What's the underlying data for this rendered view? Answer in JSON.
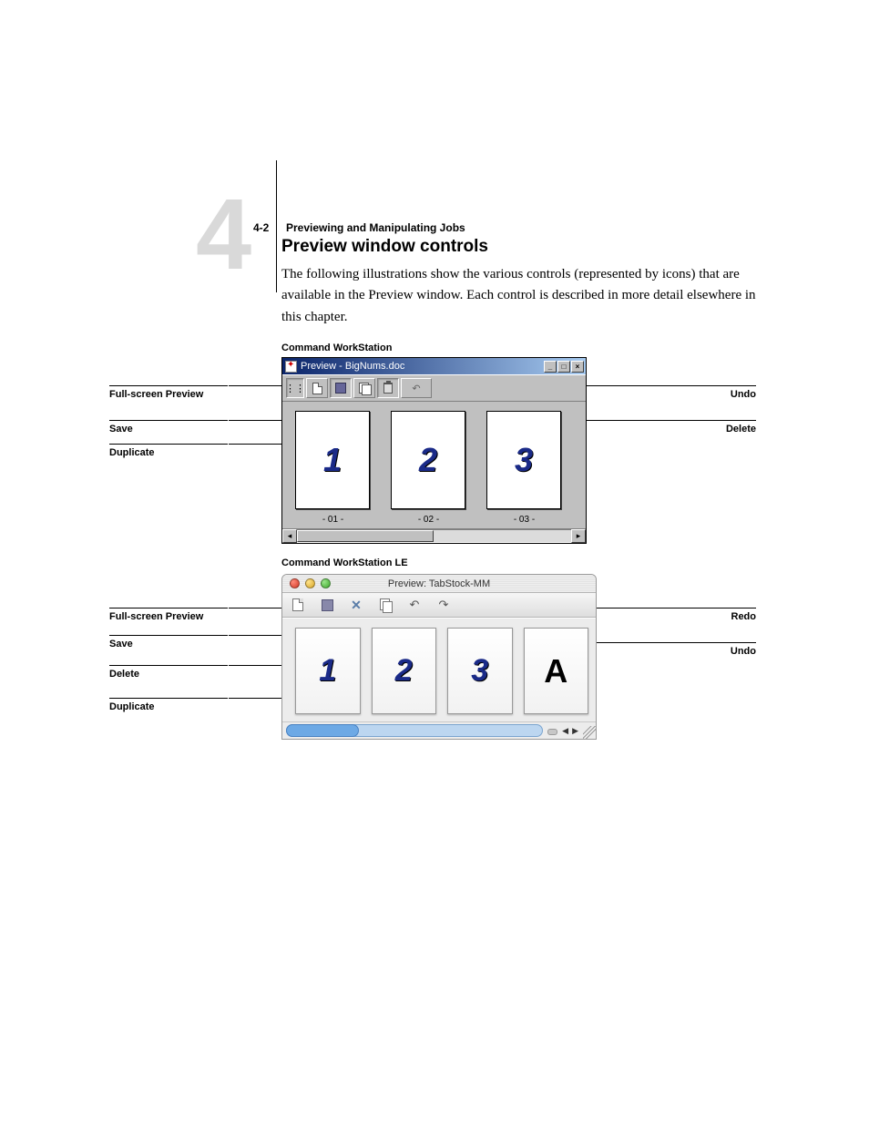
{
  "page": {
    "big_numeral": "4",
    "num": "4-2",
    "running": "Previewing and Manipulating Jobs",
    "section_title": "Preview window controls",
    "body": "The following illustrations show the various controls (represented by icons) that are available in the Preview window. Each control is described in more detail elsewhere in this chapter."
  },
  "figA": {
    "caption": "Command WorkStation",
    "window_title": "Preview - BigNums.doc",
    "thumbs": [
      {
        "num": "1",
        "label": "- 01 -"
      },
      {
        "num": "2",
        "label": "- 02 -"
      },
      {
        "num": "3",
        "label": "- 03 -"
      }
    ],
    "callouts_left": [
      {
        "label": "Full-screen Preview"
      },
      {
        "label": "Save"
      },
      {
        "label": "Duplicate"
      }
    ],
    "callouts_right": [
      {
        "label": "Undo"
      },
      {
        "label": "Delete"
      }
    ]
  },
  "figB": {
    "caption": "Command WorkStation LE",
    "window_title": "Preview: TabStock-MM",
    "thumbs": [
      "1",
      "2",
      "3",
      "A"
    ],
    "callouts_left": [
      {
        "label": "Full-screen Preview"
      },
      {
        "label": "Save"
      },
      {
        "label": "Delete"
      },
      {
        "label": "Duplicate"
      }
    ],
    "callouts_right": [
      {
        "label": "Redo"
      },
      {
        "label": "Undo"
      }
    ]
  }
}
